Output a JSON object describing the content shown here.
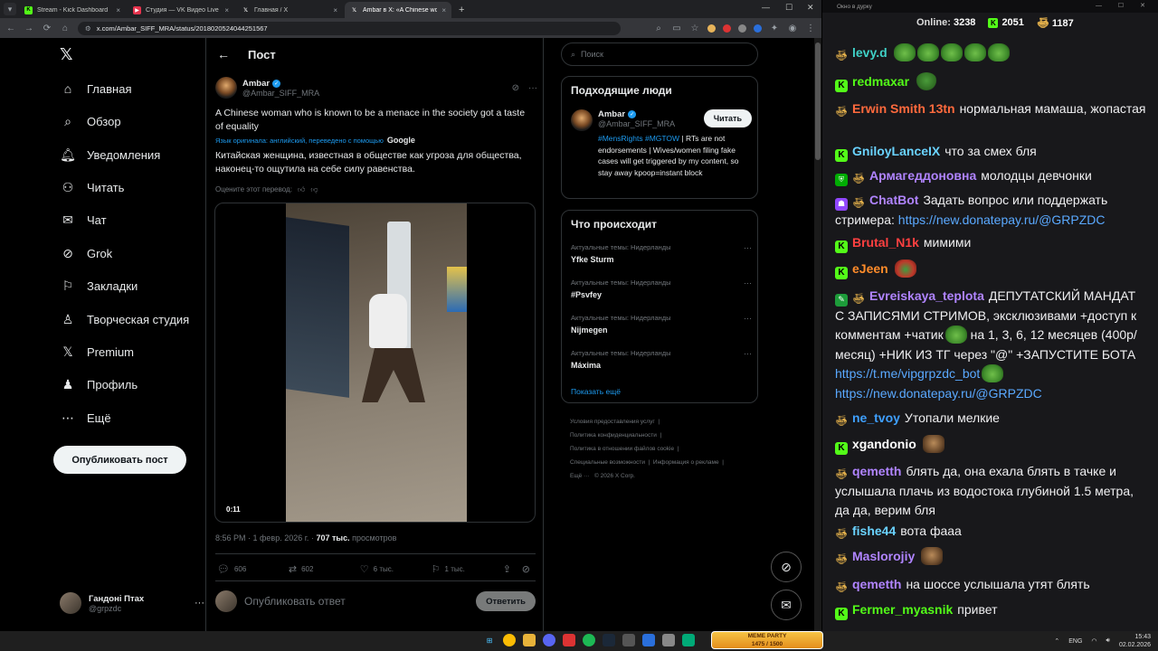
{
  "browser": {
    "tabs": [
      {
        "title": "Stream - Kick Dashboard",
        "favicon": "kick-icon",
        "active": false
      },
      {
        "title": "Студия — VK Видео Live",
        "favicon": "vk-icon",
        "active": false
      },
      {
        "title": "Главная / X",
        "favicon": "x-icon",
        "active": false
      },
      {
        "title": "Ambar в X: «A Chinese woman",
        "favicon": "x-icon",
        "active": true
      }
    ],
    "url": "x.com/Ambar_SIFF_MRA/status/2018020524044251567"
  },
  "nav": {
    "logo": "𝕏",
    "items": [
      {
        "label": "Главная",
        "icon": "home-icon"
      },
      {
        "label": "Обзор",
        "icon": "search-icon"
      },
      {
        "label": "Уведомления",
        "icon": "bell-icon"
      },
      {
        "label": "Читать",
        "icon": "add-user-icon"
      },
      {
        "label": "Чат",
        "icon": "mail-icon"
      },
      {
        "label": "Grok",
        "icon": "grok-icon"
      },
      {
        "label": "Закладки",
        "icon": "bookmark-icon"
      },
      {
        "label": "Творческая студия",
        "icon": "studio-icon"
      },
      {
        "label": "Premium",
        "icon": "x-premium-icon"
      },
      {
        "label": "Профиль",
        "icon": "person-icon"
      },
      {
        "label": "Ещё",
        "icon": "more-icon"
      }
    ],
    "post_button": "Опубликовать пост",
    "profile": {
      "name": "Гандоні Птах",
      "handle": "@grpzdc"
    }
  },
  "post": {
    "header": "Пост",
    "author_name": "Ambar",
    "author_handle": "@Ambar_SIFF_MRA",
    "text_original": "A Chinese woman who is known to be a menace in the society got a taste of equality",
    "translation_note": "Язык оригинала: английский, переведено с помощью",
    "translation_provider": "Google",
    "text_translated": "Китайская женщина, известная в обществе как угроза для общества, наконец-то ощутила на себе силу равенства.",
    "rate_translation": "Оцените этот перевод:",
    "video_time": "0:11",
    "timestamp": "8:56 PM · 1 февр. 2026 г. ·",
    "views_count": "707 тыс.",
    "views_label": "просмотров",
    "replies": "606",
    "reposts": "602",
    "likes": "6 тыс.",
    "bookmarks": "1 тыс.",
    "reply_placeholder": "Опубликовать ответ",
    "reply_button": "Ответить"
  },
  "sidebar": {
    "search_placeholder": "Поиск",
    "who_title": "Подходящие люди",
    "who": {
      "name": "Ambar",
      "handle": "@Ambar_SIFF_MRA",
      "follow": "Читать",
      "bio_tags": "#MensRights #MGTOW",
      "bio_text": "| RTs are not endorsements | Wives/women filing fake cases will get triggered by my content, so stay away kpoop=instant block"
    },
    "trends_title": "Что происходит",
    "trends": [
      {
        "context": "Актуальные темы: Нидерланды",
        "name": "Yfke Sturm"
      },
      {
        "context": "Актуальные темы: Нидерланды",
        "name": "#Psvfey"
      },
      {
        "context": "Актуальные темы: Нидерланды",
        "name": "Nijmegen"
      },
      {
        "context": "Актуальные темы: Нидерланды",
        "name": "Máxima"
      }
    ],
    "show_more": "Показать ещё",
    "footer": [
      "Условия предоставления услуг",
      "Политика конфиденциальности",
      "Политика в отношении файлов cookie",
      "Специальные возможности",
      "Информация о рекламе",
      "Ещё ···",
      "© 2026 X Corp."
    ]
  },
  "chat": {
    "window_title": "Окно в дурку",
    "online_label": "Online:",
    "online_count": "3238",
    "kick_count": "2051",
    "sub_count": "1187",
    "messages": [
      {
        "user": "levy.d",
        "color": "#3fd0c6",
        "badges": [
          "sub"
        ],
        "text": "",
        "emotes": 5
      },
      {
        "user": "redmaxar",
        "color": "#53fc18",
        "badges": [
          "kick"
        ],
        "text": "",
        "emotes": 1
      },
      {
        "user": "Erwin Smith 13tn",
        "color": "#ff6a3d",
        "badges": [
          "sub"
        ],
        "text": "нормальная мамаша, жопастая"
      },
      {
        "user": "GniloyLanceIX",
        "color": "#6ad3ff",
        "badges": [
          "kick"
        ],
        "text": "что за смех бля"
      },
      {
        "user": "Армагеддоновна",
        "color": "#b084ff",
        "badges": [
          "mod",
          "sub"
        ],
        "text": "молодцы девчонки"
      },
      {
        "user": "ChatBot",
        "color": "#b084ff",
        "badges": [
          "bot",
          "sub"
        ],
        "text": "Задать вопрос или поддержать стримера:",
        "link": "https://new.donatepay.ru/@GRPZDC"
      },
      {
        "user": "Brutal_N1k",
        "color": "#ff4040",
        "badges": [
          "kick"
        ],
        "text": "мимими"
      },
      {
        "user": "eJeen",
        "color": "#ff8c2a",
        "badges": [
          "kick"
        ],
        "text": "",
        "emotes": 1
      },
      {
        "user": "Evreiskaya_teplota",
        "color": "#b084ff",
        "badges": [
          "vip",
          "sub"
        ],
        "text": "ДЕПУТАТСКИЙ МАНДАТ С ЗАПИСЯМИ СТРИМОВ, эксклюзивами +доступ к комментам +чатик",
        "text2": "на 1, 3, 6, 12 месяцев (400р/месяц) +НИК ИЗ ТГ через \"@\" +ЗАПУСТИТЕ БОТА",
        "link": "https://t.me/vipgrpzdc_bot",
        "link2": "https://new.donatepay.ru/@GRPZDC"
      },
      {
        "user": "ne_tvoy",
        "color": "#3fa0ff",
        "badges": [
          "sub"
        ],
        "text": "Утопали мелкие"
      },
      {
        "user": "xgandonio",
        "color": "#ffffff",
        "badges": [
          "kick"
        ],
        "text": "",
        "emotes": 1
      },
      {
        "user": "qemetth",
        "color": "#b084ff",
        "badges": [
          "sub"
        ],
        "text": "блять да, она ехала блять в тачке и услышала плачь из водостока глубиной 1.5 метра, да да, верим бля"
      },
      {
        "user": "fishe44",
        "color": "#6ad3ff",
        "badges": [
          "sub"
        ],
        "text": "вота фааа"
      },
      {
        "user": "Maslorojiy",
        "color": "#b084ff",
        "badges": [
          "sub"
        ],
        "text": "",
        "emotes": 1
      },
      {
        "user": "qemetth",
        "color": "#b084ff",
        "badges": [
          "sub"
        ],
        "text": "на шоссе услышала утят блять"
      },
      {
        "user": "Fermer_myasnik",
        "color": "#53fc18",
        "badges": [
          "kick"
        ],
        "text": "привет"
      }
    ]
  },
  "taskbar": {
    "meme_title": "MEME PARTY",
    "meme_progress": "1475 / 1500",
    "lang": "ENG",
    "time": "15:43",
    "date": "02.02.2026"
  }
}
